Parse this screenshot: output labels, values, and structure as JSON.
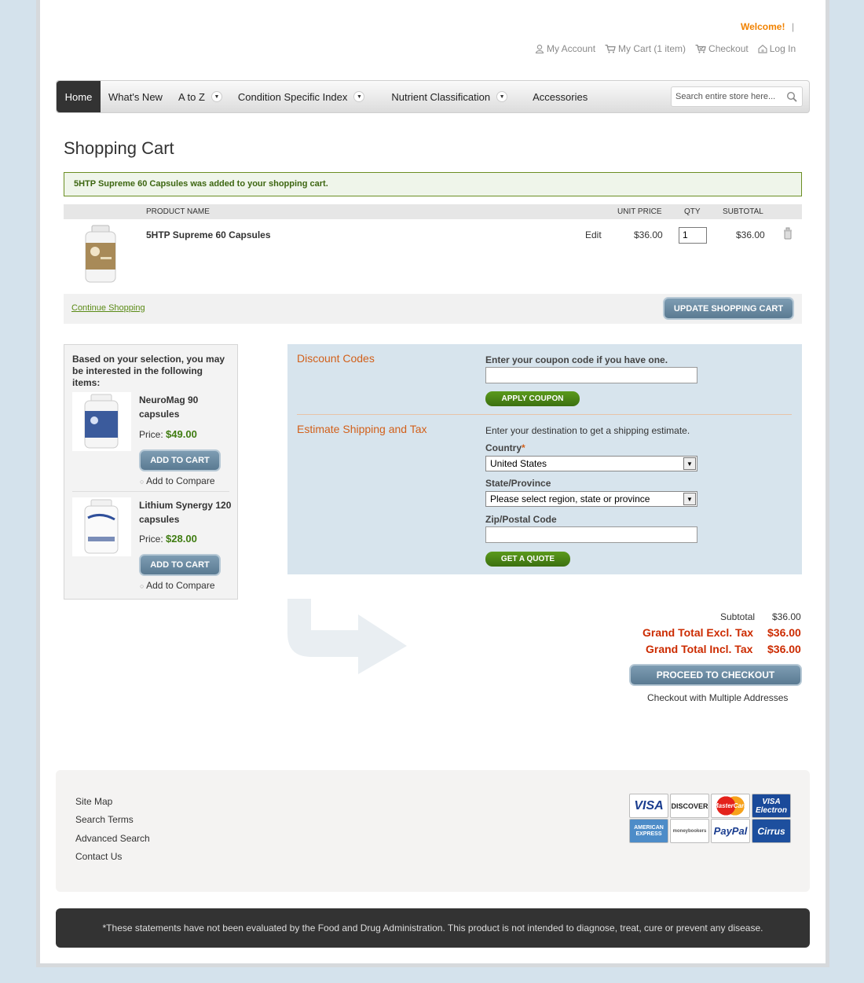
{
  "header": {
    "welcome": "Welcome!",
    "links": {
      "account": "My Account",
      "cart": "My Cart (1 item)",
      "checkout": "Checkout",
      "login": "Log In"
    }
  },
  "nav": {
    "items": [
      {
        "label": "Home"
      },
      {
        "label": "What's New"
      },
      {
        "label": "A to Z"
      },
      {
        "label": "Condition Specific Index"
      },
      {
        "label": "Nutrient Classification"
      },
      {
        "label": "Accessories"
      }
    ],
    "search_placeholder": "Search entire store here..."
  },
  "page_title": "Shopping Cart",
  "success_message": "5HTP Supreme 60 Capsules was added to your shopping cart.",
  "cart": {
    "columns": {
      "product": "PRODUCT NAME",
      "unit_price": "UNIT PRICE",
      "qty": "QTY",
      "subtotal": "SUBTOTAL"
    },
    "item": {
      "name": "5HTP Supreme 60 Capsules",
      "edit": "Edit",
      "unit_price": "$36.00",
      "qty": "1",
      "subtotal": "$36.00"
    },
    "continue": "Continue Shopping",
    "update": "UPDATE SHOPPING CART"
  },
  "crosssell": {
    "heading": "Based on your selection, you may be interested in the following items:",
    "price_label": "Price:",
    "add_to_cart": "ADD TO CART",
    "add_to_compare": "Add to Compare",
    "items": [
      {
        "name": "NeuroMag 90 capsules",
        "price": "$49.00"
      },
      {
        "name": "Lithium Synergy 120 capsules",
        "price": "$28.00"
      }
    ]
  },
  "discount": {
    "title": "Discount Codes",
    "label": "Enter your coupon code if you have one.",
    "button": "APPLY COUPON"
  },
  "shipping": {
    "title": "Estimate Shipping and Tax",
    "intro": "Enter your destination to get a shipping estimate.",
    "country_label": "Country",
    "required_mark": "*",
    "country_value": "United States",
    "region_label": "State/Province",
    "region_value": "Please select region, state or province",
    "zip_label": "Zip/Postal Code",
    "button": "GET A QUOTE"
  },
  "totals": {
    "subtotal_label": "Subtotal",
    "subtotal": "$36.00",
    "excl_label": "Grand Total Excl. Tax",
    "excl": "$36.00",
    "incl_label": "Grand Total Incl. Tax",
    "incl": "$36.00",
    "checkout": "PROCEED TO CHECKOUT",
    "multi": "Checkout with Multiple Addresses"
  },
  "footer": {
    "links": [
      "Site Map",
      "Search Terms",
      "Advanced Search",
      "Contact Us"
    ],
    "cards": [
      "VISA",
      "DISCOVER",
      "MasterCard",
      "VISA Electron",
      "AMERICAN EXPRESS",
      "moneybookers",
      "PayPal",
      "Cirrus"
    ],
    "disclaimer": "*These statements have not been evaluated by the Food and Drug Administration. This product is not intended to diagnose, treat, cure or prevent any disease."
  },
  "colors": {
    "accent_orange": "#f18200",
    "section_title": "#d2601a",
    "total_red": "#cc2b00",
    "green_button": "#4a8416",
    "blue_button": "#6a8aa2"
  }
}
